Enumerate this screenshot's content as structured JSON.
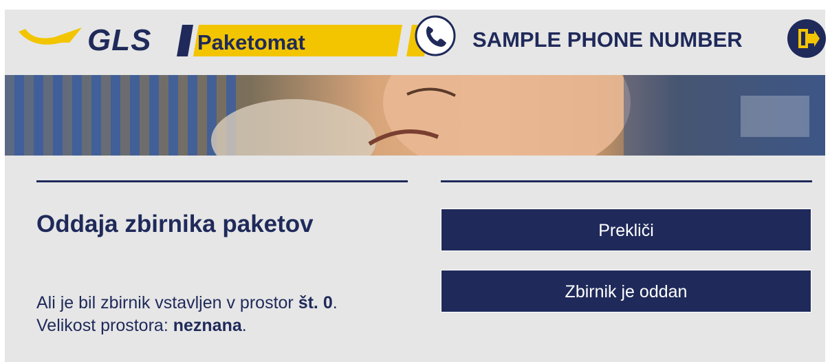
{
  "header": {
    "logo_text": "GLS",
    "brand_label": "Paketomat",
    "phone_label": "SAMPLE PHONE NUMBER",
    "icons": {
      "phone": "phone-icon",
      "exit": "exit-door-icon"
    }
  },
  "banner": {
    "image": "banner-photo-smiling-woman"
  },
  "main": {
    "title": "Oddaja zbirnika paketov",
    "message_line1_prefix": "Ali je bil zbirnik vstavljen v prostor ",
    "message_line1_value": "št. 0",
    "message_line1_suffix": ".",
    "message_line2_prefix": "Velikost prostora: ",
    "message_line2_value": "neznana",
    "message_line2_suffix": "."
  },
  "actions": {
    "cancel_label": "Prekliči",
    "confirm_label": "Zbirnik je oddan"
  },
  "colors": {
    "navy": "#1f2a5a",
    "yellow": "#f2c500",
    "background": "#e6e6e6"
  }
}
